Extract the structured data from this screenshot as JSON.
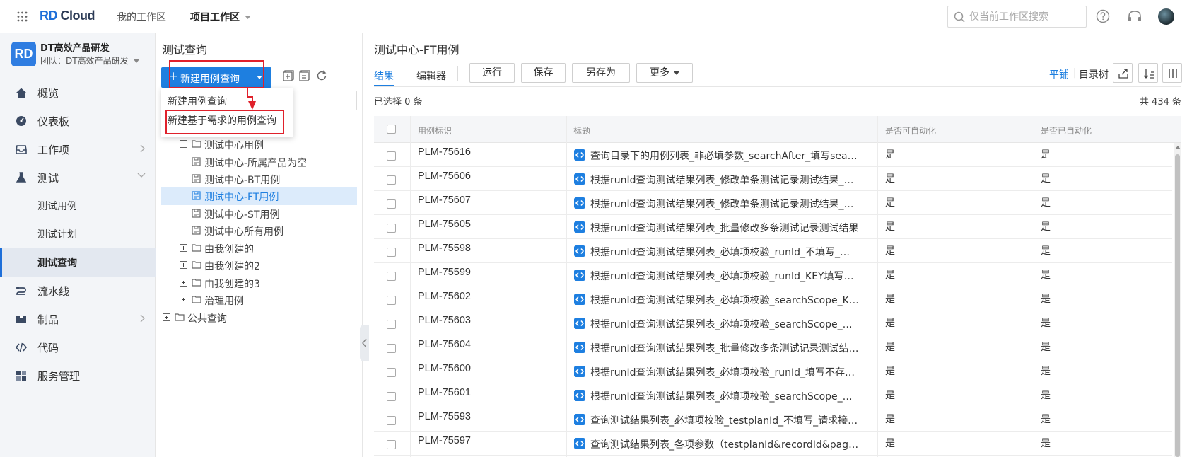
{
  "topbar": {
    "logo_rd": "RD",
    "logo_cloud": "Cloud",
    "nav": [
      "我的工作区",
      "项目工作区"
    ],
    "search_placeholder": "仅当前工作区搜索"
  },
  "sidebar": {
    "workspace_logo": "RD",
    "workspace_name": "DT高效产品研发",
    "team": "团队：DT高效产品研发",
    "items": [
      {
        "label": "概览",
        "icon": "home-icon"
      },
      {
        "label": "仪表板",
        "icon": "dashboard-icon"
      },
      {
        "label": "工作项",
        "icon": "inbox-icon"
      },
      {
        "label": "测试",
        "icon": "flask-icon"
      },
      {
        "label": "测试用例"
      },
      {
        "label": "测试计划"
      },
      {
        "label": "测试查询"
      },
      {
        "label": "流水线",
        "icon": "pipeline-icon"
      },
      {
        "label": "制品",
        "icon": "package-icon"
      },
      {
        "label": "代码",
        "icon": "code-icon"
      },
      {
        "label": "服务管理",
        "icon": "grid-icon"
      }
    ]
  },
  "query_panel": {
    "title": "测试查询",
    "new_button": "新建用例查询",
    "dropdown": [
      "新建用例查询",
      "新建基于需求的用例查询"
    ],
    "tree": [
      {
        "label": "测试中心用例"
      },
      {
        "label": "测试中心-所属产品为空"
      },
      {
        "label": "测试中心-BT用例"
      },
      {
        "label": "测试中心-FT用例"
      },
      {
        "label": "测试中心-ST用例"
      },
      {
        "label": "测试中心所有用例"
      },
      {
        "label": "由我创建的"
      },
      {
        "label": "由我创建的2"
      },
      {
        "label": "由我创建的3"
      },
      {
        "label": "治理用例"
      },
      {
        "label": "公共查询"
      }
    ]
  },
  "result_panel": {
    "title": "测试中心-FT用例",
    "tabs": [
      "结果",
      "编辑器"
    ],
    "actions": [
      "运行",
      "保存",
      "另存为",
      "更多"
    ],
    "view_flat": "平铺",
    "view_sep": "|",
    "view_tree": "目录树",
    "selected_text": "已选择 0 条",
    "total_text": "共 434 条",
    "columns": [
      "用例标识",
      "标题",
      "是否可自动化",
      "是否已自动化"
    ],
    "rows": [
      {
        "id": "PLM-75616",
        "title": "查询目录下的用例列表_非必填参数_searchAfter_填写searchAfter参数",
        "auto": "是",
        "done": "是"
      },
      {
        "id": "PLM-75606",
        "title": "根据runId查询测试结果列表_修改单条测试记录测试结果_成功",
        "auto": "是",
        "done": "是"
      },
      {
        "id": "PLM-75607",
        "title": "根据runId查询测试结果列表_修改单条测试记录测试结果_失败",
        "auto": "是",
        "done": "是"
      },
      {
        "id": "PLM-75605",
        "title": "根据runId查询测试结果列表_批量修改多条测试记录测试结果",
        "auto": "是",
        "done": "是"
      },
      {
        "id": "PLM-75598",
        "title": "根据runId查询测试结果列表_必填项校验_runId_不填写_请求失败",
        "auto": "是",
        "done": "是"
      },
      {
        "id": "PLM-75599",
        "title": "根据runId查询测试结果列表_必填项校验_runId_KEY填写错误",
        "auto": "是",
        "done": "是"
      },
      {
        "id": "PLM-75602",
        "title": "根据runId查询测试结果列表_必填项校验_searchScope_KEY填写错误",
        "auto": "是",
        "done": "是"
      },
      {
        "id": "PLM-75603",
        "title": "根据runId查询测试结果列表_必填项校验_searchScope_填写不存在的值",
        "auto": "是",
        "done": "是"
      },
      {
        "id": "PLM-75604",
        "title": "根据runId查询测试结果列表_批量修改多条测试记录测试结果失败",
        "auto": "是",
        "done": "是"
      },
      {
        "id": "PLM-75600",
        "title": "根据runId查询测试结果列表_必填项校验_runId_填写不存在的值",
        "auto": "是",
        "done": "是"
      },
      {
        "id": "PLM-75601",
        "title": "根据runId查询测试结果列表_必填项校验_searchScope_不填写",
        "auto": "是",
        "done": "是"
      },
      {
        "id": "PLM-75593",
        "title": "查询测试结果列表_必填项校验_testplanId_不填写_请求接口失败",
        "auto": "是",
        "done": "是"
      },
      {
        "id": "PLM-75597",
        "title": "查询测试结果列表_各项参数（testplanId&recordId&pageSize）",
        "auto": "是",
        "done": "是"
      }
    ]
  }
}
